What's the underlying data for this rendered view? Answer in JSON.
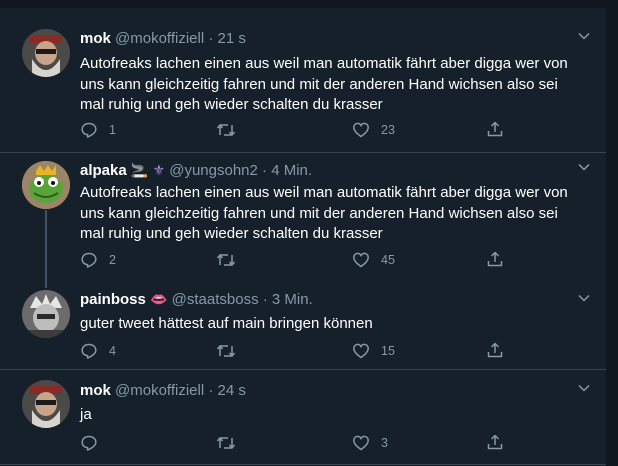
{
  "tweets": [
    {
      "name": "mok",
      "handle": "@mokoffiziell",
      "time": "21 s",
      "body": "Autofreaks lachen einen aus weil man automatik fährt aber digga wer von uns kann gleichzeitig fahren und mit der anderen Hand wichsen also sei mal ruhig und geh wieder schalten du krasser",
      "replies": "1",
      "retweets": "",
      "likes": "23"
    },
    {
      "name": "alpaka",
      "handle": "@yungsohn2",
      "time": "4 Min.",
      "body": "Autofreaks lachen einen aus weil man automatik fährt aber digga wer von uns kann gleichzeitig fahren und mit der anderen Hand wichsen also sei mal ruhig und geh wieder schalten du krasser",
      "replies": "2",
      "retweets": "",
      "likes": "45"
    },
    {
      "name": "painboss",
      "handle": "@staatsboss",
      "time": "3 Min.",
      "body": "guter tweet hättest auf main bringen können",
      "replies": "4",
      "retweets": "",
      "likes": "15"
    },
    {
      "name": "mok",
      "handle": "@mokoffiziell",
      "time": "24 s",
      "body": "ja",
      "replies": "",
      "retweets": "",
      "likes": "3"
    }
  ],
  "separator": "·",
  "icons": {
    "reply": "reply-icon",
    "retweet": "retweet-icon",
    "like": "heart-icon",
    "share": "share-icon",
    "more": "chevron-down-icon"
  },
  "colors": {
    "background": "#15202b",
    "secondary_text": "#8899a6",
    "divider": "#38444d"
  }
}
